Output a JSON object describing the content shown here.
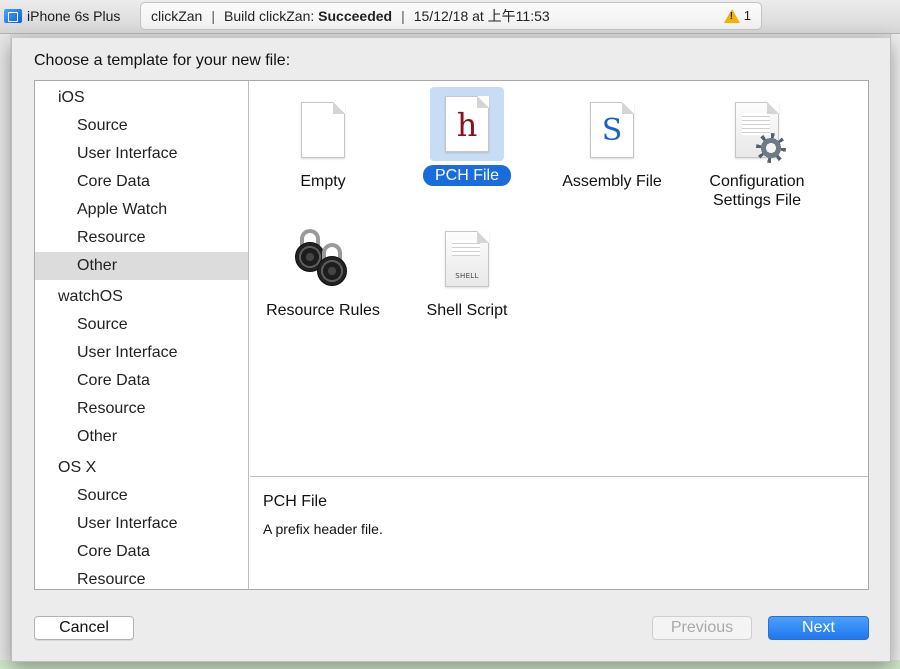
{
  "toolbar": {
    "device": "iPhone 6s Plus",
    "project": "clickZan",
    "build_prefix": "Build clickZan:",
    "build_status": "Succeeded",
    "timestamp": "15/12/18 at 上午11:53",
    "warning_count": "1"
  },
  "dialog": {
    "title": "Choose a template for your new file:",
    "cancel_label": "Cancel",
    "previous_label": "Previous",
    "next_label": "Next"
  },
  "sidebar": {
    "items": [
      {
        "label": "iOS",
        "kind": "platform"
      },
      {
        "label": "Source",
        "kind": "sub"
      },
      {
        "label": "User Interface",
        "kind": "sub"
      },
      {
        "label": "Core Data",
        "kind": "sub"
      },
      {
        "label": "Apple Watch",
        "kind": "sub"
      },
      {
        "label": "Resource",
        "kind": "sub"
      },
      {
        "label": "Other",
        "kind": "sub",
        "selected": true
      },
      {
        "label": "watchOS",
        "kind": "platform"
      },
      {
        "label": "Source",
        "kind": "sub"
      },
      {
        "label": "User Interface",
        "kind": "sub"
      },
      {
        "label": "Core Data",
        "kind": "sub"
      },
      {
        "label": "Resource",
        "kind": "sub"
      },
      {
        "label": "Other",
        "kind": "sub"
      },
      {
        "label": "OS X",
        "kind": "platform"
      },
      {
        "label": "Source",
        "kind": "sub"
      },
      {
        "label": "User Interface",
        "kind": "sub"
      },
      {
        "label": "Core Data",
        "kind": "sub"
      },
      {
        "label": "Resource",
        "kind": "sub"
      }
    ]
  },
  "templates": [
    {
      "label": "Empty",
      "icon": "blank-document-icon"
    },
    {
      "label": "PCH File",
      "icon": "header-h-document-icon",
      "selected": true
    },
    {
      "label": "Assembly File",
      "icon": "assembly-s-document-icon"
    },
    {
      "label": "Configuration Settings File",
      "icon": "settings-gear-document-icon"
    },
    {
      "label": "Resource Rules",
      "icon": "padlocks-icon"
    },
    {
      "label": "Shell Script",
      "icon": "shell-document-icon",
      "badge": "SHELL"
    }
  ],
  "description": {
    "title": "PCH File",
    "text": "A prefix header file."
  },
  "colors": {
    "accent": "#1a6cdd",
    "selection_tile": "#c9dcf5",
    "sidebar_selected": "#dcdcdc",
    "header_glyph": "#8a1120",
    "assembly_glyph": "#1b63c4",
    "warning": "#f2b100"
  }
}
